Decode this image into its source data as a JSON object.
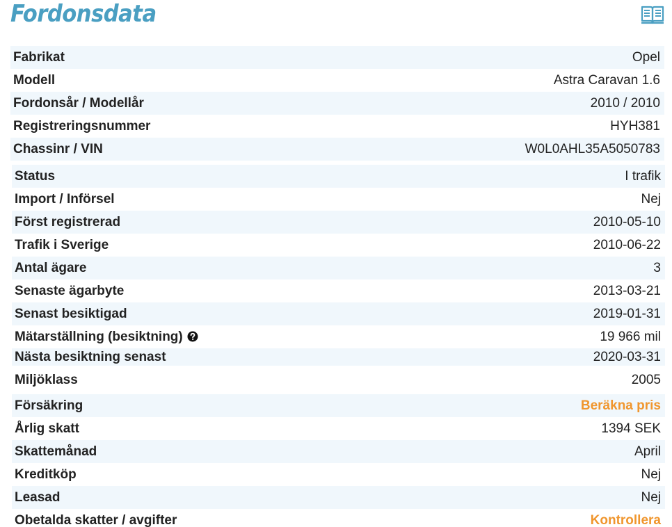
{
  "header": {
    "title": "Fordonsdata",
    "icon": "book-icon"
  },
  "colors": {
    "title": "#4a9fc2",
    "row_shade": "#f0f7fc",
    "link": "#f0962e"
  },
  "vehicle": [
    {
      "label": "Fabrikat",
      "value": "Opel"
    },
    {
      "label": "Modell",
      "value": "Astra Caravan 1.6"
    },
    {
      "label": "Fordonsår / Modellår",
      "value": "2010 / 2010"
    },
    {
      "label": "Registreringsnummer",
      "value": "HYH381"
    },
    {
      "label": "Chassinr / VIN",
      "value": "W0L0AHL35A5050783"
    }
  ],
  "details": [
    {
      "label": "Status",
      "value": "I trafik"
    },
    {
      "label": "Import / Införsel",
      "value": "Nej"
    },
    {
      "label": "Först registrerad",
      "value": "2010-05-10"
    },
    {
      "label": "Trafik i Sverige",
      "value": "2010-06-22"
    },
    {
      "label": "Antal ägare",
      "value": "3"
    },
    {
      "label": "Senaste ägarbyte",
      "value": "2013-03-21"
    },
    {
      "label": "Senast besiktigad",
      "value": "2019-01-31"
    },
    {
      "label": "Mätarställning (besiktning)",
      "value": "19 966 mil",
      "icon": "question-circle-icon"
    },
    {
      "label": "Nästa besiktning senast",
      "value": "2020-03-31"
    },
    {
      "label": "Miljöklass",
      "value": "2005"
    },
    {
      "label": "Försäkring",
      "value": "Beräkna pris"
    },
    {
      "label": "Årlig skatt",
      "value": "1394 SEK"
    },
    {
      "label": "Skattemånad",
      "value": "April"
    },
    {
      "label": "Kreditköp",
      "value": "Nej"
    },
    {
      "label": "Leasad",
      "value": "Nej"
    },
    {
      "label": "Obetalda skatter / avgifter",
      "value": "Kontrollera"
    }
  ]
}
